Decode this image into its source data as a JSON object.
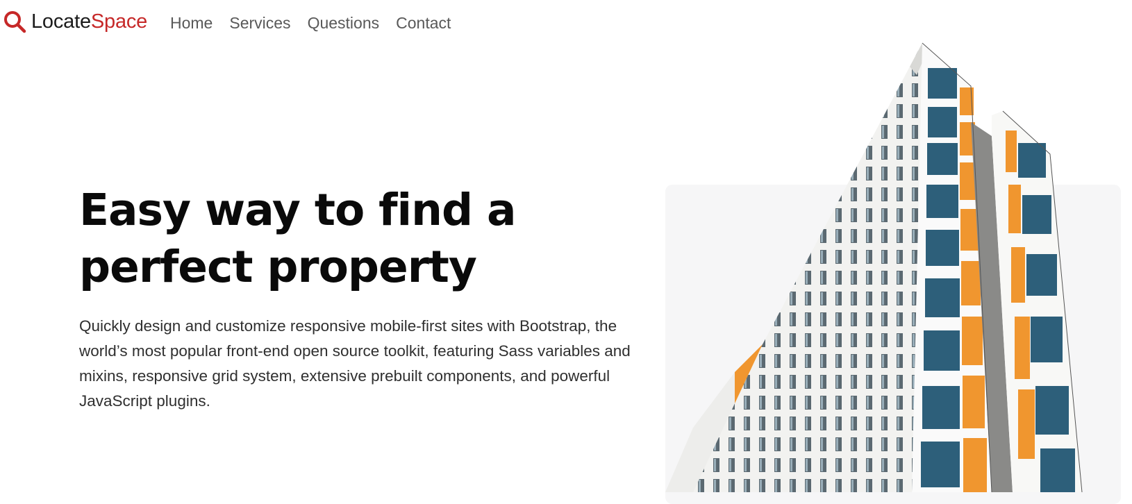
{
  "brand": {
    "part1": "Locate",
    "part2": "Space",
    "icon": "search-icon",
    "accent_color": "#c62828"
  },
  "nav": {
    "items": [
      {
        "label": "Home"
      },
      {
        "label": "Services"
      },
      {
        "label": "Questions"
      },
      {
        "label": "Contact"
      }
    ]
  },
  "hero": {
    "title_line1": "Easy way to find a",
    "title_line2": "perfect property",
    "description": "Quickly design and customize responsive mobile-first sites with Bootstrap, the world’s most popular front-end open source toolkit, featuring Sass variables and mixins, responsive grid system, extensive prebuilt components, and powerful JavaScript plugins."
  },
  "colors": {
    "building_orange": "#f0962f",
    "window_blue": "#2d5f7a",
    "panel_bg": "#f6f6f7"
  }
}
